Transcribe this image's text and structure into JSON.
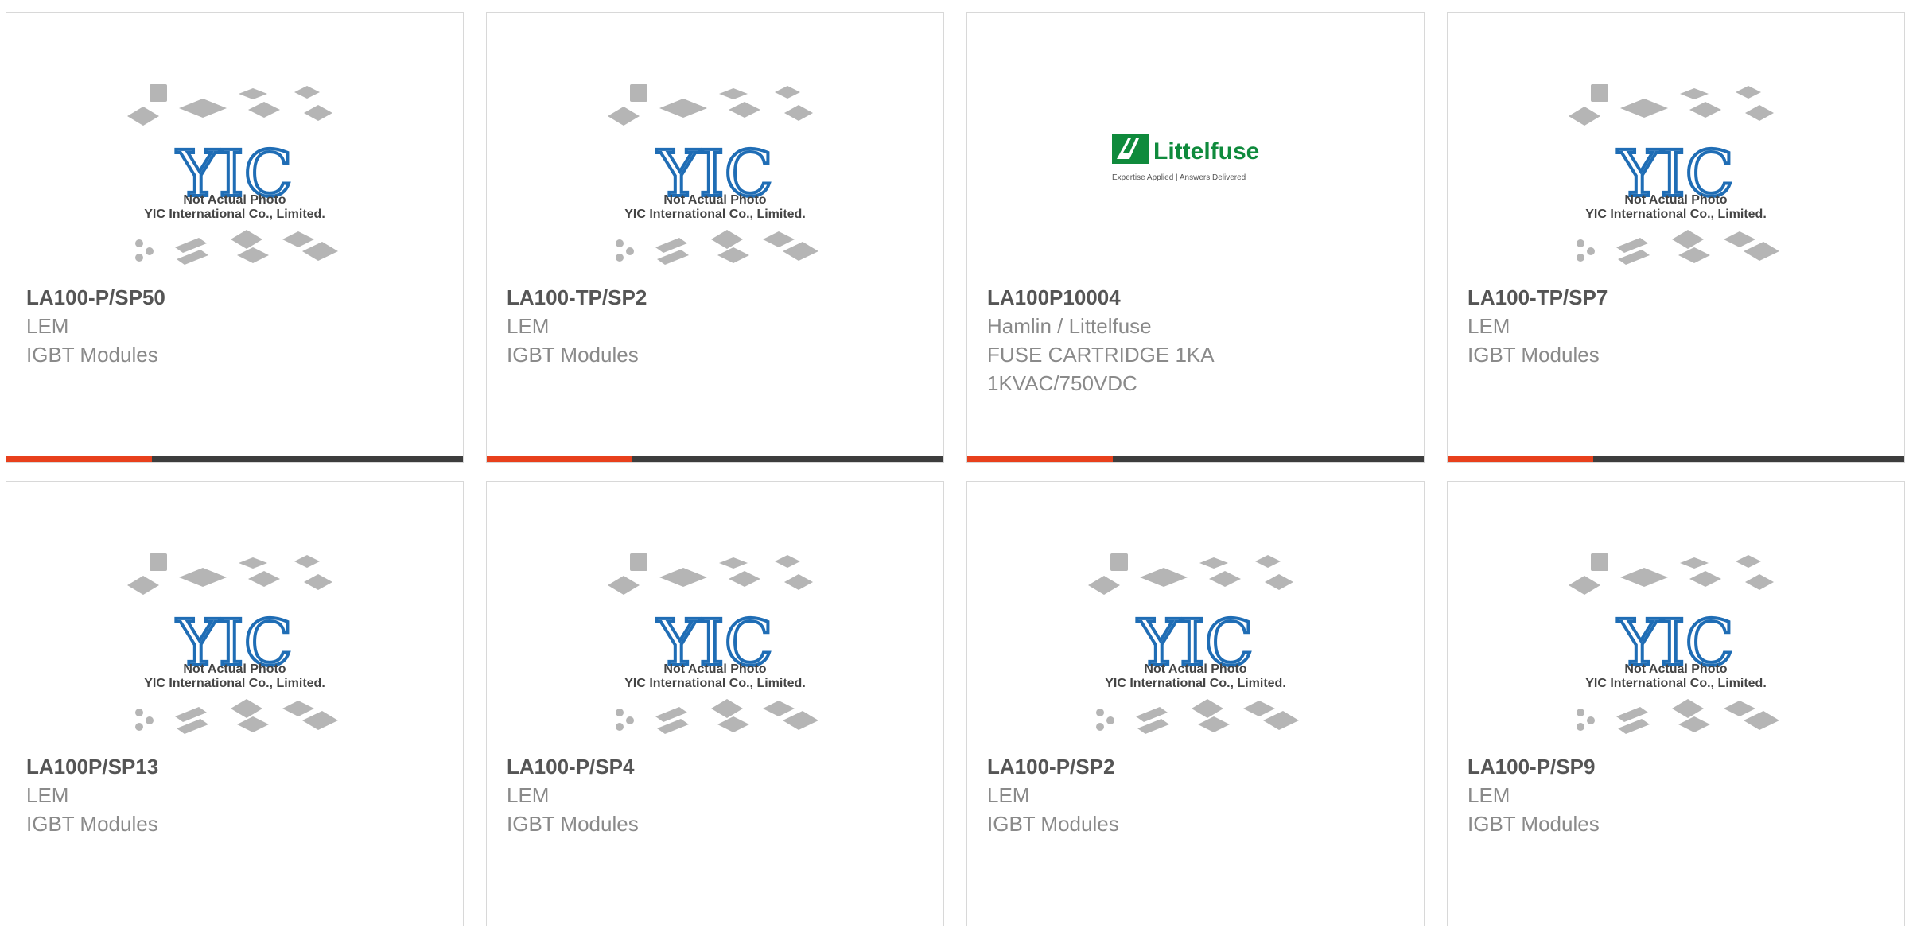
{
  "colors": {
    "accent": "#e8401c",
    "bar": "#3d3d3d",
    "yic_blue": "#1f6db5",
    "littelfuse_green": "#0f8a3c"
  },
  "placeholder": {
    "line1": "Not Actual Photo",
    "line2": "YIC International Co., Limited."
  },
  "products": [
    {
      "part_number": "LA100-P/SP50",
      "manufacturer": "LEM",
      "description": "IGBT Modules",
      "image": "yic-placeholder"
    },
    {
      "part_number": "LA100-TP/SP2",
      "manufacturer": "LEM",
      "description": "IGBT Modules",
      "image": "yic-placeholder"
    },
    {
      "part_number": "LA100P10004",
      "manufacturer": "Hamlin / Littelfuse",
      "description": "FUSE CARTRIDGE 1KA 1KVAC/750VDC",
      "image": "littelfuse-logo",
      "logo_text": "Littelfuse",
      "logo_tagline": "Expertise Applied | Answers Delivered"
    },
    {
      "part_number": "LA100-TP/SP7",
      "manufacturer": "LEM",
      "description": "IGBT Modules",
      "image": "yic-placeholder"
    },
    {
      "part_number": "LA100P/SP13",
      "manufacturer": "LEM",
      "description": "IGBT Modules",
      "image": "yic-placeholder"
    },
    {
      "part_number": "LA100-P/SP4",
      "manufacturer": "LEM",
      "description": "IGBT Modules",
      "image": "yic-placeholder"
    },
    {
      "part_number": "LA100-P/SP2",
      "manufacturer": "LEM",
      "description": "IGBT Modules",
      "image": "yic-placeholder"
    },
    {
      "part_number": "LA100-P/SP9",
      "manufacturer": "LEM",
      "description": "IGBT Modules",
      "image": "yic-placeholder"
    }
  ]
}
